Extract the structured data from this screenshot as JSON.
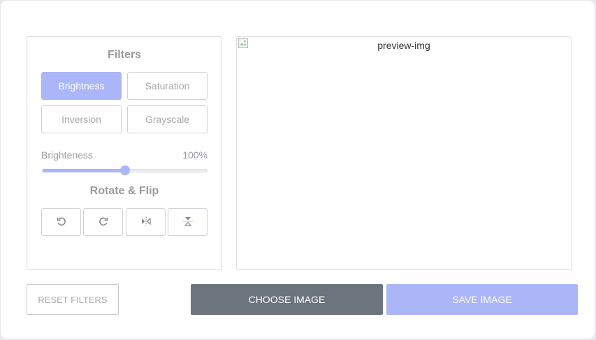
{
  "filters": {
    "title": "Filters",
    "options": [
      {
        "label": "Brightness",
        "active": true
      },
      {
        "label": "Saturation",
        "active": false
      },
      {
        "label": "Inversion",
        "active": false
      },
      {
        "label": "Grayscale",
        "active": false
      }
    ],
    "slider": {
      "label": "Brighteness",
      "value_text": "100%",
      "fraction": 0.5
    }
  },
  "rotate_flip": {
    "title": "Rotate & Flip",
    "buttons": [
      {
        "icon": "rotate-left-icon"
      },
      {
        "icon": "rotate-right-icon"
      },
      {
        "icon": "flip-horizontal-icon"
      },
      {
        "icon": "flip-vertical-icon"
      }
    ]
  },
  "preview": {
    "alt_text": "preview-img",
    "broken_image_icon": "broken-image-icon"
  },
  "actions": {
    "reset_label": "RESET FILTERS",
    "choose_label": "CHOOSE IMAGE",
    "save_label": "SAVE IMAGE"
  },
  "colors": {
    "accent": "#aab6f7",
    "choose_bg": "#6c757d",
    "muted_text": "#9c9ca3"
  }
}
